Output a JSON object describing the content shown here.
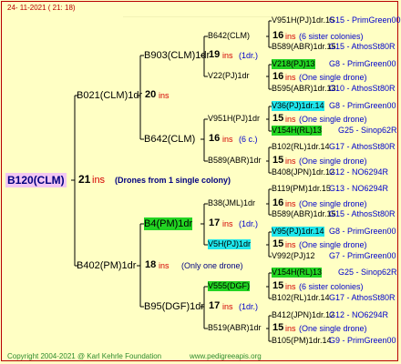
{
  "header": {
    "date": "24- 11-2021 ( 21: 18)"
  },
  "root": {
    "id": "B120(CLM)",
    "year": "21",
    "ins": "ins",
    "note": "(Drones from 1 single colony)"
  },
  "gen1": [
    {
      "id": "B021(CLM)1dr",
      "year": "20",
      "ins": "ins"
    },
    {
      "id": "B402(PM)1dr",
      "year": "18",
      "ins": "ins",
      "note": "(Only one drone)"
    }
  ],
  "gen2": [
    {
      "id": "B903(CLM)1dr",
      "year": "19",
      "ins": "ins",
      "note": "(1dr.)"
    },
    {
      "id": "B642(CLM)",
      "year": "16",
      "ins": "ins",
      "note": "(6 c.)"
    },
    {
      "id": "B4(PM)1dr",
      "year": "17",
      "ins": "ins",
      "note": "(1dr.)"
    },
    {
      "id": "B95(DGF)1dr",
      "year": "17",
      "ins": "ins",
      "note": "(1dr.)"
    }
  ],
  "gen3": [
    {
      "id": "B642(CLM)",
      "year": "16",
      "ins": "ins",
      "note": "(6 sister colonies)"
    },
    {
      "id": "V22(PJ)1dr",
      "year": "16",
      "ins": "ins",
      "note": "(One single drone)"
    },
    {
      "id": "V951H(PJ)1dr",
      "year": "15",
      "ins": "ins",
      "note": "(One single drone)"
    },
    {
      "id": "B589(ABR)1dr",
      "year": "15",
      "ins": "ins",
      "note": "(One single drone)"
    },
    {
      "id": "B38(JML)1dr",
      "year": "16",
      "ins": "ins",
      "note": "(One single drone)"
    },
    {
      "id": "V5H(PJ)1dr",
      "year": "15",
      "ins": "ins",
      "note": "(One single drone)"
    },
    {
      "id": "V555(DGF)",
      "year": "15",
      "ins": "ins",
      "note": "(6 sister colonies)"
    },
    {
      "id": "B519(ABR)1dr",
      "year": "15",
      "ins": "ins",
      "note": "(One single drone)"
    }
  ],
  "gen4": [
    {
      "id": "V951H(PJ)1dr.15",
      "line": "G15 - PrimGreen00"
    },
    {
      "id": "B589(ABR)1dr.15",
      "line": "G15 - AthosSt80R"
    },
    {
      "id": "V218(PJ)13",
      "line": "G8 - PrimGreen00"
    },
    {
      "id": "B595(ABR)1dr.13",
      "line": "G10 - AthosSt80R"
    },
    {
      "id": "V36(PJ)1dr.14",
      "line": "G8 - PrimGreen00"
    },
    {
      "id": "V154H(RL)13",
      "line": "G25 - Sinop62R"
    },
    {
      "id": "B102(RL)1dr.14",
      "line": "G17 - AthosSt80R"
    },
    {
      "id": "B408(JPN)1dr.12",
      "line": "G12 - NO6294R"
    },
    {
      "id": "B119(PM)1dr.15",
      "line": "G13 - NO6294R"
    },
    {
      "id": "B589(ABR)1dr.15",
      "line": "G15 - AthosSt80R"
    },
    {
      "id": "V95(PJ)1dr.14",
      "line": "G8 - PrimGreen00"
    },
    {
      "id": "V992(PJ)12",
      "line": "G7 - PrimGreen00"
    },
    {
      "id": "V154H(RL)13",
      "line": "G25 - Sinop62R"
    },
    {
      "id": "B102(RL)1dr.14",
      "line": "G17 - AthosSt80R"
    },
    {
      "id": "B412(JPN)1dr.12",
      "line": "G12 - NO6294R"
    },
    {
      "id": "B105(PM)1dr.14",
      "line": "G9 - PrimGreen00"
    }
  ],
  "footer": {
    "copyright": "Copyright 2004-2021 @ Karl Kehrle Foundation",
    "site": "www.pedigreeapis.org"
  }
}
